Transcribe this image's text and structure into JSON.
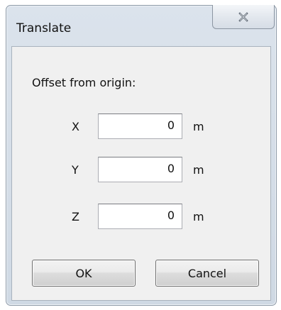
{
  "window": {
    "title": "Translate",
    "close_icon": "close-icon"
  },
  "offset_group": {
    "label": "Offset from origin:",
    "fields": [
      {
        "axis": "X",
        "value": "0",
        "unit": "m"
      },
      {
        "axis": "Y",
        "value": "0",
        "unit": "m"
      },
      {
        "axis": "Z",
        "value": "0",
        "unit": "m"
      }
    ]
  },
  "buttons": {
    "ok_label": "OK",
    "cancel_label": "Cancel"
  }
}
